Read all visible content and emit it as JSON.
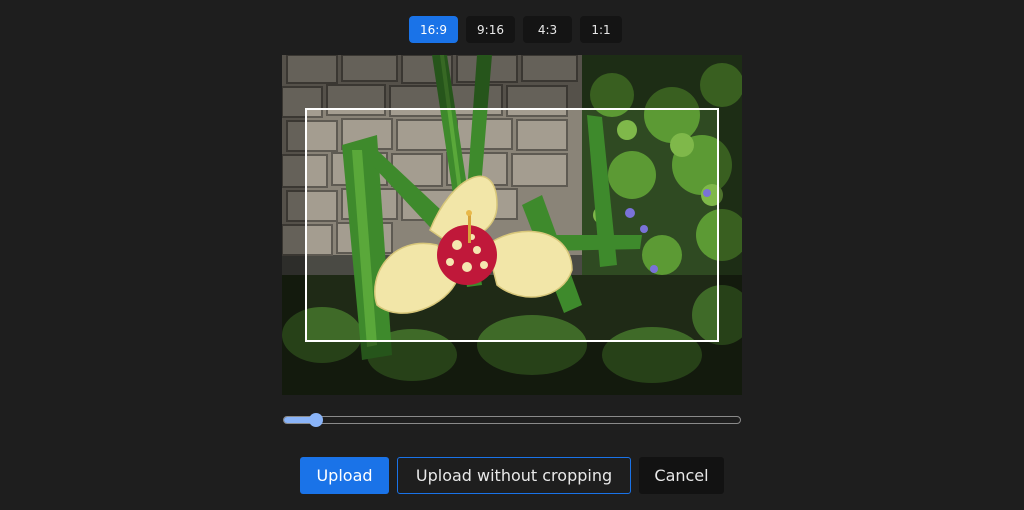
{
  "aspect_ratios": {
    "options": [
      "16:9",
      "9:16",
      "4:3",
      "1:1"
    ],
    "selected": "16:9"
  },
  "image": {
    "description_icon": "flower-photo"
  },
  "zoom": {
    "value_fraction": 0.07
  },
  "actions": {
    "upload_label": "Upload",
    "upload_without_cropping_label": "Upload without cropping",
    "cancel_label": "Cancel"
  },
  "colors": {
    "background": "#1e1e1e",
    "accent": "#1a73e8",
    "slider": "#8ab4f8",
    "button_dark": "#141414"
  }
}
